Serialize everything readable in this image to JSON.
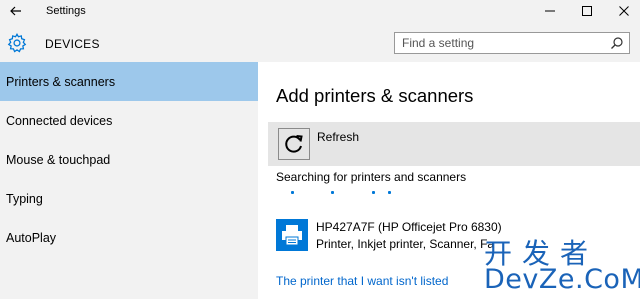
{
  "window": {
    "title": "Settings",
    "back_icon": "back-arrow-icon",
    "minimize_icon": "minimize-icon",
    "maximize_icon": "maximize-icon",
    "close_icon": "close-icon"
  },
  "header": {
    "icon": "gear-icon",
    "title": "DEVICES",
    "search_placeholder": "Find a setting",
    "search_value": "",
    "search_icon": "search-icon"
  },
  "sidebar": {
    "items": [
      {
        "label": "Printers & scanners",
        "active": true
      },
      {
        "label": "Connected devices",
        "active": false
      },
      {
        "label": "Mouse & touchpad",
        "active": false
      },
      {
        "label": "Typing",
        "active": false
      },
      {
        "label": "AutoPlay",
        "active": false
      }
    ]
  },
  "main": {
    "heading": "Add printers & scanners",
    "refresh_label": "Refresh",
    "refresh_icon": "refresh-icon",
    "searching_text": "Searching for printers and scanners",
    "printer": {
      "icon": "printer-icon",
      "name": "HP427A7F (HP Officejet Pro 6830)",
      "description": "Printer, Inkjet printer, Scanner, Fa"
    },
    "not_listed_link": "The printer that I want isn't listed"
  },
  "watermark": {
    "top": "开发者",
    "bottom": "DevZe.CoM"
  },
  "colors": {
    "accent": "#0078d7",
    "active_nav": "#9dc8eb",
    "link": "#0066cc",
    "watermark": "#1a63b8"
  }
}
